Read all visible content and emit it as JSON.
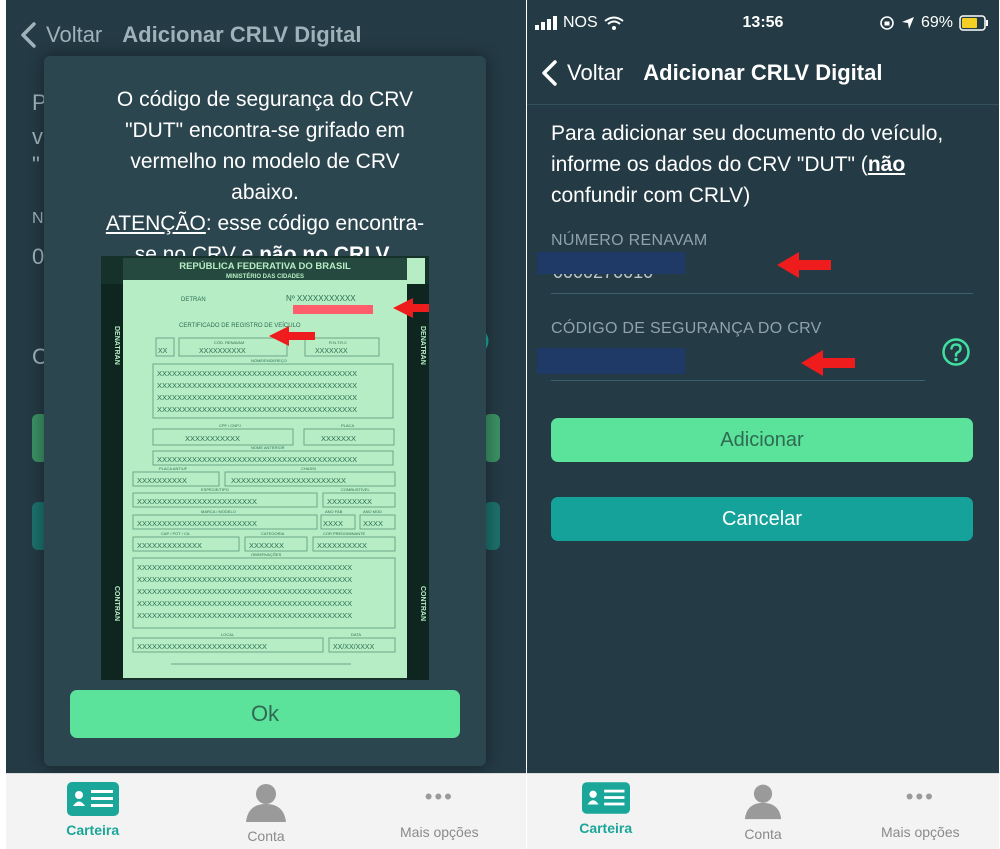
{
  "left": {
    "nav": {
      "back_label": "Voltar",
      "title": "Adicionar CRLV Digital"
    },
    "background": {
      "line1": "P",
      "line2": "v",
      "line3": "\"",
      "line4": "N",
      "line5": "0",
      "line6": "C"
    },
    "modal": {
      "text_line1": "O código de segurança do CRV",
      "text_line2": "\"DUT\" encontra-se grifado em",
      "text_line3": "vermelho no modelo de CRV",
      "text_line4": "abaixo.",
      "attention": "ATENÇÃO",
      "text_line5_rest": ": esse código encontra-",
      "text_line6_pre": "se no CRV e ",
      "text_line6_bold": "não no CRLV",
      "text_line6_end": ".",
      "ok_label": "Ok",
      "crv_doc": {
        "header1": "REPÚBLICA FEDERATIVA DO BRASIL",
        "header2": "MINISTÉRIO DAS CIDADES",
        "side_top": "DENATRAN",
        "side_bottom": "CONTRAN",
        "detran": "DETRAN",
        "numero": "Nº XXXXXXXXXXX",
        "cert": "CERTIFICADO DE REGISTRO DE VEÍCULO",
        "xmask": "XXXXXXXXXXXXXXXXXXXXXXXXXXXXXXXXX",
        "cod_renavam": "CÓD. RENAVAM",
        "rntrc": "R.N.T.R.C",
        "nome": "NOME/ENDEREÇO",
        "cpf": "CPF / CNPJ",
        "placa": "PLACA",
        "nome_anterior": "NOME ANTERIOR",
        "placa_ant": "PLACA ANT/UF",
        "chassi": "CHASSI",
        "especie": "ESPÉCIE/TIPO",
        "combustivel": "COMBUSTÍVEL",
        "marca": "MARCA / MODELO",
        "ano_fab": "ANO FAB",
        "ano_mod": "ANO MOD",
        "cap": "CAP / POT / CIL",
        "categoria": "CATEGORIA",
        "cor": "COR PREDOMINANTE",
        "observacoes": "OBSERVAÇÕES",
        "local": "LOCAL",
        "data": "DATA",
        "data_val": "XX/XX/XXXX",
        "vs": "XX"
      }
    },
    "tabs": [
      {
        "label": "Carteira",
        "icon": "wallet-card-icon"
      },
      {
        "label": "Conta",
        "icon": "person-icon"
      },
      {
        "label": "Mais opções",
        "icon": "more-dots-icon"
      }
    ]
  },
  "right": {
    "status": {
      "carrier": "NOS",
      "time": "13:56",
      "battery": "69%"
    },
    "nav": {
      "back_label": "Voltar",
      "title": "Adicionar CRLV Digital"
    },
    "intro_pre": "Para adicionar seu documento do veículo, informe os dados do CRV \"DUT\" (",
    "intro_bold": "não",
    "intro_post": " confundir com CRLV)",
    "renavam_label": "NÚMERO RENAVAM",
    "renavam_value_partial": "0000270010-",
    "seguranca_label": "CÓDIGO DE SEGURANÇA DO CRV",
    "add_label": "Adicionar",
    "cancel_label": "Cancelar",
    "tabs": [
      {
        "label": "Carteira",
        "icon": "wallet-card-icon"
      },
      {
        "label": "Conta",
        "icon": "person-icon"
      },
      {
        "label": "Mais opções",
        "icon": "more-dots-icon"
      }
    ]
  },
  "colors": {
    "background": "#243a44",
    "accent_green": "#5be39b",
    "teal": "#15a29a",
    "highlight_red": "#ff2a2a"
  }
}
